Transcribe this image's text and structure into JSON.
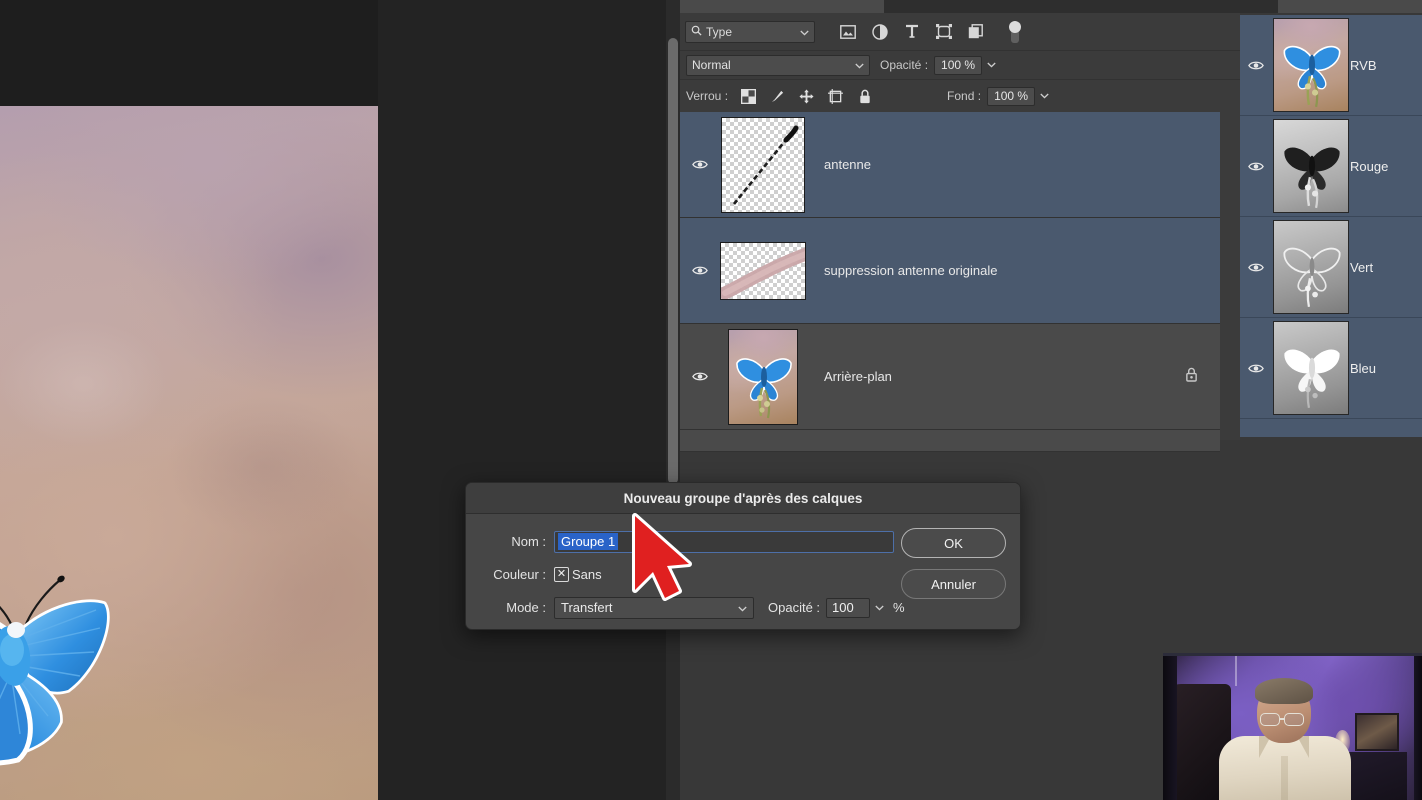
{
  "app": {
    "accent_selected": "#4a596e",
    "panel_bg": "#383838",
    "row_bg": "#4a4a4a",
    "highlight_blue": "#2a63c8"
  },
  "canvas": {
    "name": "document-canvas",
    "subject": "blue-butterfly-photo"
  },
  "layers_panel": {
    "filter": {
      "search_icon": "search-icon",
      "value": "Type",
      "chevron": "chevron-down-icon",
      "icons": [
        {
          "name": "filter-pixel-icon",
          "title": "Pixels"
        },
        {
          "name": "filter-adjustment-icon",
          "title": "Reglage"
        },
        {
          "name": "filter-type-icon",
          "title": "Texte"
        },
        {
          "name": "filter-shape-icon",
          "title": "Forme"
        },
        {
          "name": "filter-smart-object-icon",
          "title": "Objet dynamique"
        }
      ],
      "toggle": "filter-enable-toggle"
    },
    "blend": {
      "mode_value": "Normal",
      "opacity_label": "Opacité :",
      "opacity_value": "100 %"
    },
    "lock": {
      "label": "Verrou :",
      "icons": [
        {
          "name": "lock-transparency-icon"
        },
        {
          "name": "lock-image-icon"
        },
        {
          "name": "lock-position-icon"
        },
        {
          "name": "lock-artboard-icon"
        },
        {
          "name": "lock-all-icon"
        }
      ],
      "fill_label": "Fond :",
      "fill_value": "100 %"
    },
    "layers": [
      {
        "name": "antenne",
        "selected": true,
        "visible": true,
        "locked": false,
        "thumb": "antenna-stroke"
      },
      {
        "name": "suppression antenne originale",
        "selected": true,
        "visible": true,
        "locked": false,
        "thumb": "pink-brush-stroke"
      },
      {
        "name": "Arrière-plan",
        "selected": false,
        "visible": true,
        "locked": true,
        "thumb": "butterfly-photo"
      }
    ]
  },
  "channels_panel": {
    "channels": [
      {
        "name": "RVB",
        "visible": true,
        "thumb": "rgb-composite"
      },
      {
        "name": "Rouge",
        "visible": true,
        "thumb": "red-channel"
      },
      {
        "name": "Vert",
        "visible": true,
        "thumb": "green-channel"
      },
      {
        "name": "Bleu",
        "visible": true,
        "thumb": "blue-channel"
      }
    ]
  },
  "dialog": {
    "title": "Nouveau groupe d'après des calques",
    "name_label": "Nom :",
    "name_value": "Groupe 1",
    "color_label": "Couleur :",
    "color_value": "Sans",
    "color_swatch_icon": "x-box-icon",
    "mode_label": "Mode :",
    "mode_value": "Transfert",
    "opacity_label": "Opacité :",
    "opacity_value": "100",
    "percent_symbol": "%",
    "ok_label": "OK",
    "cancel_label": "Annuler"
  },
  "cursor": {
    "name": "mouse-pointer",
    "color": "#e02020"
  },
  "webcam": {
    "name": "webcam-overlay"
  }
}
